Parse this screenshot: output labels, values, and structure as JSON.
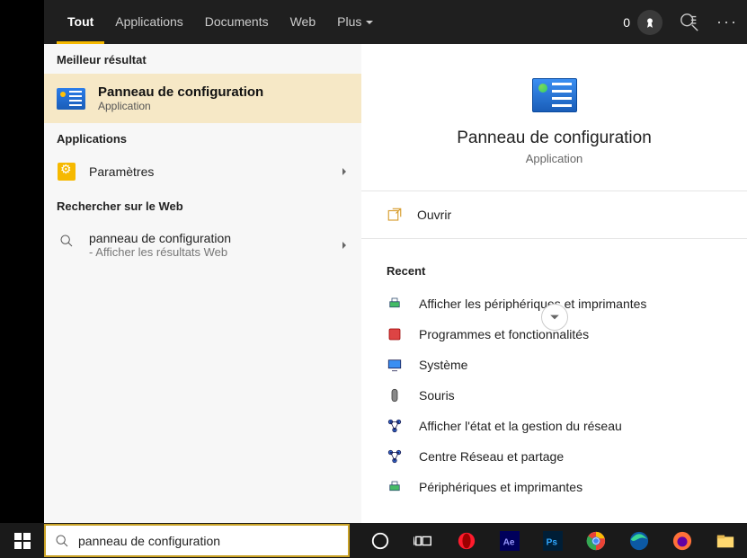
{
  "tabs": {
    "all": "Tout",
    "apps": "Applications",
    "docs": "Documents",
    "web": "Web",
    "more": "Plus",
    "points": "0"
  },
  "left": {
    "best_header": "Meilleur résultat",
    "best_title": "Panneau de configuration",
    "best_sub": "Application",
    "apps_header": "Applications",
    "settings_label": "Paramètres",
    "web_header": "Rechercher sur le Web",
    "web_query": "panneau de configuration",
    "web_suffix": "- Afficher les résultats Web"
  },
  "preview": {
    "title": "Panneau de configuration",
    "sub": "Application",
    "open": "Ouvrir",
    "recent_header": "Recent",
    "recent": [
      "Afficher les périphériques et imprimantes",
      "Programmes et fonctionnalités",
      "Système",
      "Souris",
      "Afficher l'état et la gestion du réseau",
      "Centre Réseau et partage",
      "Périphériques et imprimantes"
    ]
  },
  "search": {
    "value": "panneau de configuration"
  }
}
